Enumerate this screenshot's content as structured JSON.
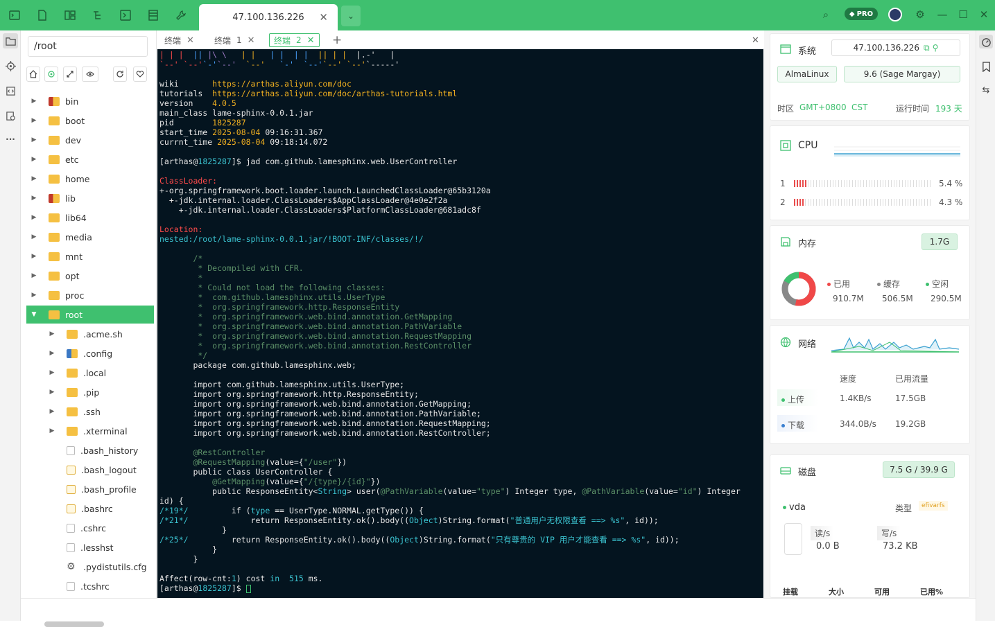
{
  "app": {
    "session_tab": "47.100.136.226",
    "pro_label": "PRO",
    "accent": "#3fc06f"
  },
  "files": {
    "path": "/root",
    "tree": [
      {
        "name": "bin",
        "type": "folder-special",
        "level": 0
      },
      {
        "name": "boot",
        "type": "folder",
        "level": 0
      },
      {
        "name": "dev",
        "type": "folder",
        "level": 0
      },
      {
        "name": "etc",
        "type": "folder",
        "level": 0
      },
      {
        "name": "home",
        "type": "folder",
        "level": 0
      },
      {
        "name": "lib",
        "type": "folder-special",
        "level": 0
      },
      {
        "name": "lib64",
        "type": "folder",
        "level": 0
      },
      {
        "name": "media",
        "type": "folder",
        "level": 0
      },
      {
        "name": "mnt",
        "type": "folder",
        "level": 0
      },
      {
        "name": "opt",
        "type": "folder",
        "level": 0
      },
      {
        "name": "proc",
        "type": "folder",
        "level": 0
      },
      {
        "name": "root",
        "type": "folder",
        "level": 0,
        "selected": true,
        "open": true
      },
      {
        "name": ".acme.sh",
        "type": "folder",
        "level": 1
      },
      {
        "name": ".config",
        "type": "folder-blue",
        "level": 1
      },
      {
        "name": ".local",
        "type": "folder",
        "level": 1
      },
      {
        "name": ".pip",
        "type": "folder",
        "level": 1
      },
      {
        "name": ".ssh",
        "type": "folder",
        "level": 1
      },
      {
        "name": ".xterminal",
        "type": "folder",
        "level": 1
      },
      {
        "name": ".bash_history",
        "type": "file",
        "level": 1
      },
      {
        "name": ".bash_logout",
        "type": "file-term",
        "level": 1
      },
      {
        "name": ".bash_profile",
        "type": "file-term",
        "level": 1
      },
      {
        "name": ".bashrc",
        "type": "file-term",
        "level": 1
      },
      {
        "name": ".cshrc",
        "type": "file",
        "level": 1
      },
      {
        "name": ".lesshst",
        "type": "file",
        "level": 1
      },
      {
        "name": ".pydistutils.cfg",
        "type": "gear",
        "level": 1
      },
      {
        "name": ".tcshrc",
        "type": "file",
        "level": 1
      }
    ]
  },
  "terminal": {
    "tabs": [
      {
        "label": "终端",
        "num": "",
        "active": false
      },
      {
        "label": "终端",
        "num": "1",
        "active": false
      },
      {
        "label": "终端",
        "num": "2",
        "active": true
      }
    ],
    "lines": [
      [
        [
          "c-r",
          "| | |  "
        ],
        [
          "c-lb",
          "|| "
        ],
        [
          "c-p",
          "|\\ \\   "
        ],
        [
          "c-y",
          "| |   "
        ],
        [
          "c-lb",
          "| |  | |  "
        ],
        [
          "c-y",
          "|| | |  "
        ],
        [
          "",
          "|.-'   |"
        ]
      ],
      [
        [
          "c-r",
          "`--' `--'"
        ],
        [
          "c-lb",
          "`-'"
        ],
        [
          "c-p",
          "`--'  "
        ],
        [
          "c-y",
          "`--'   "
        ],
        [
          "c-lb",
          "`-'  `--'"
        ],
        [
          "c-y",
          "`--' `--'"
        ],
        [
          "",
          "`-----'"
        ]
      ],
      [
        [
          "",
          ""
        ]
      ],
      [
        [
          "",
          "wiki       "
        ],
        [
          "c-y",
          "https://arthas.aliyun.com/doc"
        ]
      ],
      [
        [
          "",
          "tutorials  "
        ],
        [
          "c-y",
          "https://arthas.aliyun.com/doc/arthas-tutorials.html"
        ]
      ],
      [
        [
          "",
          "version    "
        ],
        [
          "c-y",
          "4.0.5"
        ]
      ],
      [
        [
          "",
          "main_class "
        ],
        [
          "",
          "lame-sphinx-0.0.1.jar"
        ]
      ],
      [
        [
          "",
          "pid        "
        ],
        [
          "c-y",
          "1825287"
        ]
      ],
      [
        [
          "",
          "start_time "
        ],
        [
          "c-y",
          "2025-08-04 "
        ],
        [
          "",
          "09:16:31.367"
        ]
      ],
      [
        [
          "",
          "currnt_time "
        ],
        [
          "c-y",
          "2025-08-04 "
        ],
        [
          "",
          "09:18:14.072"
        ]
      ],
      [
        [
          "",
          ""
        ]
      ],
      [
        [
          "",
          "[arthas@"
        ],
        [
          "c-c",
          "1825287"
        ],
        [
          "",
          "]$ jad com.github.lamesphinx.web.UserController"
        ]
      ],
      [
        [
          "",
          ""
        ]
      ],
      [
        [
          "c-r",
          "ClassLoader:"
        ]
      ],
      [
        [
          "",
          "+-org.springframework.boot.loader.launch.LaunchedClassLoader@65b3120a"
        ]
      ],
      [
        [
          "",
          "  +-jdk.internal.loader.ClassLoaders$AppClassLoader@4e0e2f2a"
        ]
      ],
      [
        [
          "",
          "    +-jdk.internal.loader.ClassLoaders$PlatformClassLoader@681adc8f"
        ]
      ],
      [
        [
          "",
          ""
        ]
      ],
      [
        [
          "c-r",
          "Location:"
        ]
      ],
      [
        [
          "c-c",
          "nested:/root/lame-sphinx-0.0.1.jar/!BOOT-INF/classes/!/"
        ]
      ],
      [
        [
          "",
          ""
        ]
      ],
      [
        [
          "c-g",
          "       /*"
        ]
      ],
      [
        [
          "c-g",
          "        * Decompiled with CFR."
        ]
      ],
      [
        [
          "c-g",
          "        *"
        ]
      ],
      [
        [
          "c-g",
          "        * Could not load the following classes:"
        ]
      ],
      [
        [
          "c-g",
          "        *  com.github.lamesphinx.utils.UserType"
        ]
      ],
      [
        [
          "c-g",
          "        *  org.springframework.http.ResponseEntity"
        ]
      ],
      [
        [
          "c-g",
          "        *  org.springframework.web.bind.annotation.GetMapping"
        ]
      ],
      [
        [
          "c-g",
          "        *  org.springframework.web.bind.annotation.PathVariable"
        ]
      ],
      [
        [
          "c-g",
          "        *  org.springframework.web.bind.annotation.RequestMapping"
        ]
      ],
      [
        [
          "c-g",
          "        *  org.springframework.web.bind.annotation.RestController"
        ]
      ],
      [
        [
          "c-g",
          "        */"
        ]
      ],
      [
        [
          "",
          "       package com.github.lamesphinx.web;"
        ]
      ],
      [
        [
          "",
          ""
        ]
      ],
      [
        [
          "",
          "       import com.github.lamesphinx.utils.UserType;"
        ]
      ],
      [
        [
          "",
          "       import org.springframework.http.ResponseEntity;"
        ]
      ],
      [
        [
          "",
          "       import org.springframework.web.bind.annotation.GetMapping;"
        ]
      ],
      [
        [
          "",
          "       import org.springframework.web.bind.annotation.PathVariable;"
        ]
      ],
      [
        [
          "",
          "       import org.springframework.web.bind.annotation.RequestMapping;"
        ]
      ],
      [
        [
          "",
          "       import org.springframework.web.bind.annotation.RestController;"
        ]
      ],
      [
        [
          "",
          ""
        ]
      ],
      [
        [
          "c-g",
          "       @RestController"
        ]
      ],
      [
        [
          "c-g",
          "       @RequestMapping"
        ],
        [
          "",
          "(value={"
        ],
        [
          "c-g",
          "\"/user\""
        ],
        [
          "",
          "})"
        ]
      ],
      [
        [
          "",
          "       public class UserController {"
        ]
      ],
      [
        [
          "c-g",
          "           @GetMapping"
        ],
        [
          "",
          "(value={"
        ],
        [
          "c-g",
          "\"/{type}/{id}\""
        ],
        [
          "",
          "})"
        ]
      ],
      [
        [
          "",
          "           public ResponseEntity<"
        ],
        [
          "c-c",
          "String"
        ],
        [
          "",
          "> user("
        ],
        [
          "c-g",
          "@PathVariable"
        ],
        [
          "",
          "(value="
        ],
        [
          "c-g",
          "\"type\""
        ],
        [
          "",
          ") Integer type, "
        ],
        [
          "c-g",
          "@PathVariable"
        ],
        [
          "",
          "(value="
        ],
        [
          "c-g",
          "\"id\""
        ],
        [
          "",
          ") Integer"
        ]
      ],
      [
        [
          "",
          "id) {"
        ]
      ],
      [
        [
          "c-c",
          "/*19*/"
        ],
        [
          "",
          "         if ("
        ],
        [
          "c-c",
          "type"
        ],
        [
          "",
          " == UserType.NORMAL.getType()) {"
        ]
      ],
      [
        [
          "c-c",
          "/*21*/"
        ],
        [
          "",
          "             return ResponseEntity.ok().body(("
        ],
        [
          "c-c",
          "Object"
        ],
        [
          "",
          ")String.format("
        ],
        [
          "c-c",
          "\"普通用户无权限查看 ==> %s\""
        ],
        [
          "",
          ", id));"
        ]
      ],
      [
        [
          "",
          "             }"
        ]
      ],
      [
        [
          "c-c",
          "/*25*/"
        ],
        [
          "",
          "         return ResponseEntity.ok().body(("
        ],
        [
          "c-c",
          "Object"
        ],
        [
          "",
          ")String.format("
        ],
        [
          "c-c",
          "\"只有尊贵的 VIP 用户才能查看 ==> %s\""
        ],
        [
          "",
          ", id));"
        ]
      ],
      [
        [
          "",
          "           }"
        ]
      ],
      [
        [
          "",
          "       }"
        ]
      ],
      [
        [
          "",
          ""
        ]
      ],
      [
        [
          "",
          "Affect(row-cnt:"
        ],
        [
          "c-c",
          "1"
        ],
        [
          "",
          ") cost "
        ],
        [
          "c-c",
          "in"
        ],
        [
          "",
          "  "
        ],
        [
          "c-c",
          "515"
        ],
        [
          "",
          " ms."
        ]
      ],
      [
        [
          "",
          "[arthas@"
        ],
        [
          "c-c",
          "1825287"
        ],
        [
          "",
          "]$ "
        ]
      ]
    ]
  },
  "system": {
    "title": "系统",
    "ip": "47.100.136.226",
    "os": "AlmaLinux",
    "os_version": "9.6 (Sage Margay)",
    "tz_label": "时区",
    "tz_value": "GMT+0800",
    "tz_name": "CST",
    "uptime_label": "运行时间",
    "uptime_value": "193 天"
  },
  "cpu": {
    "title": "CPU",
    "cores": [
      {
        "index": "1",
        "percent": "5.4 %",
        "fraction": 0.054
      },
      {
        "index": "2",
        "percent": "4.3 %",
        "fraction": 0.043
      }
    ]
  },
  "memory": {
    "title": "内存",
    "total": "1.7G",
    "used_label": "已用",
    "used": "910.7M",
    "cache_label": "缓存",
    "cache": "506.5M",
    "free_label": "空闲",
    "free": "290.5M",
    "colors": {
      "used": "#f04848",
      "cache": "#888888",
      "free": "#3fc06f"
    }
  },
  "network": {
    "title": "网络",
    "speed_header": "速度",
    "traffic_header": "已用流量",
    "upload_label": "上传",
    "upload_speed": "1.4KB/s",
    "upload_total": "17.5GB",
    "download_label": "下载",
    "download_speed": "344.0B/s",
    "download_total": "19.2GB"
  },
  "disk": {
    "title": "磁盘",
    "usage": "7.5 G / 39.9 G",
    "device": "vda",
    "type_label": "类型",
    "type_value": "efivarfs",
    "read_label": "读/s",
    "read_value": "0.0 B",
    "write_label": "写/s",
    "write_value": "73.2 KB",
    "cols": [
      "挂载",
      "大小",
      "可用",
      "已用%"
    ]
  }
}
